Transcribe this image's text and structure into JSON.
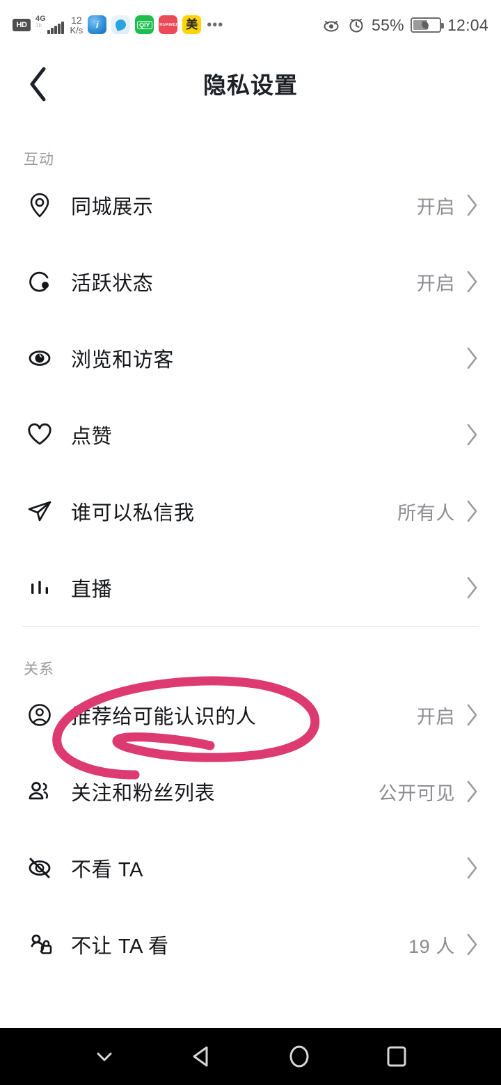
{
  "status_bar": {
    "hd_badge": "HD",
    "network_generation": "4G",
    "network_sub": "1b",
    "net_speed_value": "12",
    "net_speed_unit": "K/s",
    "app_icons": [
      {
        "name": "browser-app-icon",
        "label": "i"
      },
      {
        "name": "cloud-app-icon",
        "label": ""
      },
      {
        "name": "iqiyi-app-icon",
        "label": "QIY"
      },
      {
        "name": "huawei-app-icon",
        "label": "HUAWEI"
      },
      {
        "name": "meituan-app-icon",
        "label": "美"
      }
    ],
    "overflow": "•••",
    "eye_comfort_icon": "eye-icon",
    "alarm_icon": "alarm-icon",
    "battery_percent": "55%",
    "clock": "12:04"
  },
  "header": {
    "back_icon": "chevron-left-icon",
    "title": "隐私设置"
  },
  "sections": [
    {
      "title": "互动",
      "rows": [
        {
          "icon": "location-pin-icon",
          "label": "同城展示",
          "value": "开启"
        },
        {
          "icon": "activity-status-icon",
          "label": "活跃状态",
          "value": "开启"
        },
        {
          "icon": "eye-icon",
          "label": "浏览和访客",
          "value": ""
        },
        {
          "icon": "heart-icon",
          "label": "点赞",
          "value": ""
        },
        {
          "icon": "paper-plane-icon",
          "label": "谁可以私信我",
          "value": "所有人"
        },
        {
          "icon": "live-bars-icon",
          "label": "直播",
          "value": ""
        }
      ]
    },
    {
      "title": "关系",
      "rows": [
        {
          "icon": "user-circle-icon",
          "label": "推荐给可能认识的人",
          "value": "开启"
        },
        {
          "icon": "users-icon",
          "label": "关注和粉丝列表",
          "value": "公开可见"
        },
        {
          "icon": "eye-off-icon",
          "label": "不看 TA",
          "value": ""
        },
        {
          "icon": "user-lock-icon",
          "label": "不让 TA 看",
          "value": "19 人"
        }
      ]
    }
  ],
  "annotation": {
    "name": "handdrawn-circle-annotation",
    "color": "#DD3A72",
    "target_label": "推荐给可能认识的人"
  },
  "nav_bar": {
    "buttons": [
      {
        "name": "nav-hide-keyboard-button",
        "icon": "chevron-down-icon"
      },
      {
        "name": "nav-back-button",
        "icon": "triangle-left-icon"
      },
      {
        "name": "nav-home-button",
        "icon": "circle-icon"
      },
      {
        "name": "nav-recents-button",
        "icon": "square-icon"
      }
    ]
  },
  "colors": {
    "accent_pink": "#DD3A72",
    "text_primary": "#14161a",
    "text_secondary": "#8c8c92",
    "divider": "#e8e8ea"
  }
}
